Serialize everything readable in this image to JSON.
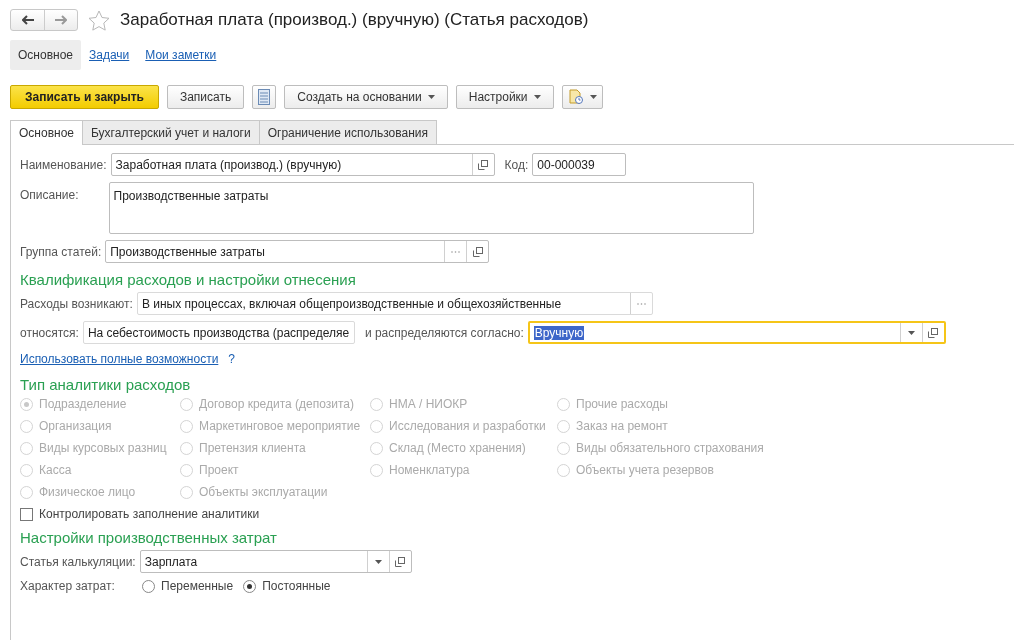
{
  "window": {
    "title": "Заработная плата (производ.) (вручную) (Статья расходов)",
    "favorite": false
  },
  "sections": [
    {
      "label": "Основное",
      "selected": true
    },
    {
      "label": "Задачи",
      "selected": false
    },
    {
      "label": "Мои заметки",
      "selected": false
    }
  ],
  "toolbar": [
    {
      "kind": "primary",
      "label": "Записать и закрыть"
    },
    {
      "kind": "plain",
      "label": "Записать"
    },
    {
      "kind": "icon"
    },
    {
      "kind": "dropdown",
      "label": "Создать на основании"
    },
    {
      "kind": "dropdown",
      "label": "Настройки"
    },
    {
      "kind": "icon_dropdown"
    }
  ],
  "tabs": [
    {
      "label": "Основное",
      "selected": true
    },
    {
      "label": "Бухгалтерский учет и налоги",
      "selected": false
    },
    {
      "label": "Ограничение использования",
      "selected": false
    }
  ],
  "name": {
    "label": "Наименование:",
    "value": "Заработная плата (производ.) (вручную)"
  },
  "code": {
    "label": "Код:",
    "value": "00-000039"
  },
  "description": {
    "label": "Описание:",
    "value": "Производственные затраты"
  },
  "group": {
    "label": "Группа статей:",
    "value": "Производственные затраты"
  },
  "qualification": {
    "heading": "Квалификация расходов и настройки отнесения",
    "arise": {
      "label": "Расходы возникают:",
      "value": "В иных процессах, включая общепроизводственные и общехозяйственные"
    },
    "relate": {
      "label": "относятся:",
      "value": "На себестоимость производства (распределяе"
    },
    "distribute": {
      "label": "и распределяются согласно:",
      "value": "Вручную",
      "focused": true
    },
    "link": "Использовать полные возможности",
    "help": "?"
  },
  "analytics": {
    "heading": "Тип аналитики расходов",
    "disabled": true,
    "options": [
      {
        "label": "Подразделение",
        "selected": true
      },
      {
        "label": "Договор кредита (депозита)",
        "selected": false
      },
      {
        "label": "НМА / НИОКР",
        "selected": false
      },
      {
        "label": "Прочие расходы",
        "selected": false
      },
      {
        "label": "Организация",
        "selected": false
      },
      {
        "label": "Маркетинговое мероприятие",
        "selected": false
      },
      {
        "label": "Исследования и разработки",
        "selected": false
      },
      {
        "label": "Заказ на ремонт",
        "selected": false
      },
      {
        "label": "Виды курсовых разниц",
        "selected": false
      },
      {
        "label": "Претензия клиента",
        "selected": false
      },
      {
        "label": "Склад (Место хранения)",
        "selected": false
      },
      {
        "label": "Виды обязательного страхования",
        "selected": false
      },
      {
        "label": "Касса",
        "selected": false
      },
      {
        "label": "Проект",
        "selected": false
      },
      {
        "label": "Номенклатура",
        "selected": false
      },
      {
        "label": "Объекты учета резервов",
        "selected": false
      },
      {
        "label": "Физическое лицо",
        "selected": false
      },
      {
        "label": "Объекты эксплуатации",
        "selected": false
      }
    ],
    "control": {
      "label": "Контролировать заполнение аналитики",
      "checked": false
    }
  },
  "production": {
    "heading": "Настройки производственных затрат",
    "item": {
      "label": "Статья калькуляции:",
      "value": "Зарплата"
    },
    "nature": {
      "label": "Характер затрат:",
      "options": [
        {
          "label": "Переменные",
          "selected": false
        },
        {
          "label": "Постоянные",
          "selected": true
        }
      ]
    }
  }
}
